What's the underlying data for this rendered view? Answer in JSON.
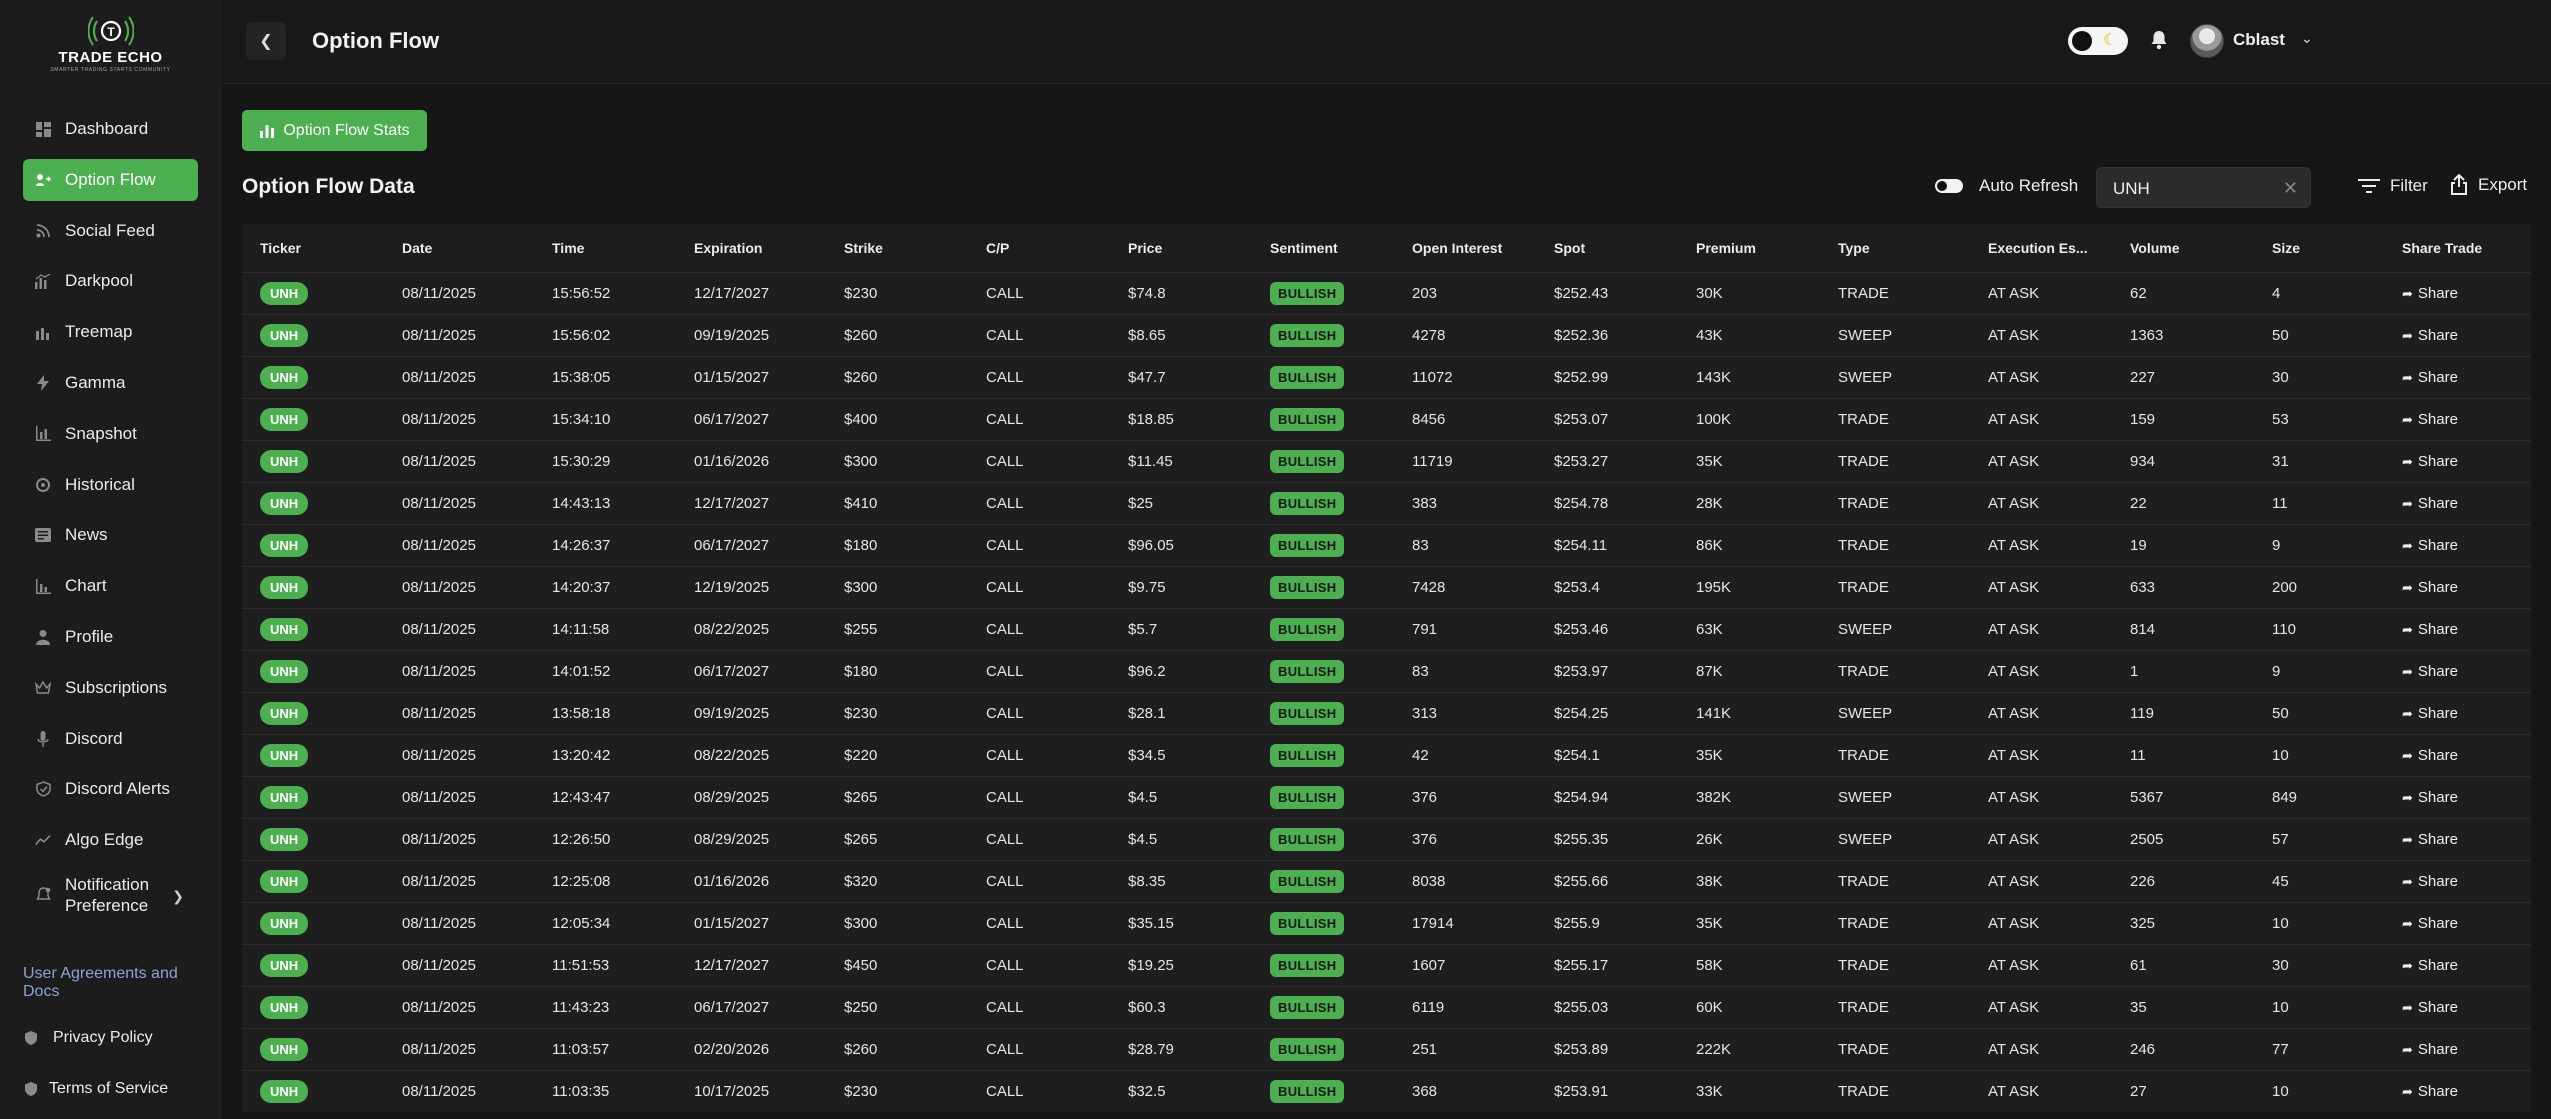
{
  "brand": {
    "name_part1": "TRADE",
    "name_part2": "ECHO",
    "tagline": "SMARTER TRADING STARTS COMMUNITY"
  },
  "sidebar": {
    "items": [
      {
        "label": "Dashboard",
        "icon": "dashboard-icon",
        "active": false
      },
      {
        "label": "Option Flow",
        "icon": "option-flow-icon",
        "active": true
      },
      {
        "label": "Social Feed",
        "icon": "rss-icon",
        "active": false
      },
      {
        "label": "Darkpool",
        "icon": "darkpool-icon",
        "active": false
      },
      {
        "label": "Treemap",
        "icon": "treemap-icon",
        "active": false
      },
      {
        "label": "Gamma",
        "icon": "bolt-icon",
        "active": false
      },
      {
        "label": "Snapshot",
        "icon": "snapshot-icon",
        "active": false
      },
      {
        "label": "Historical",
        "icon": "historical-icon",
        "active": false
      },
      {
        "label": "News",
        "icon": "news-icon",
        "active": false
      },
      {
        "label": "Chart",
        "icon": "chart-icon",
        "active": false
      },
      {
        "label": "Profile",
        "icon": "user-icon",
        "active": false
      },
      {
        "label": "Subscriptions",
        "icon": "crown-icon",
        "active": false
      },
      {
        "label": "Discord",
        "icon": "mic-icon",
        "active": false
      },
      {
        "label": "Discord Alerts",
        "icon": "shield-alert-icon",
        "active": false
      },
      {
        "label": "Algo Edge",
        "icon": "trend-icon",
        "active": false
      }
    ],
    "notification_label_line1": "Notification",
    "notification_label_line2": "Preference",
    "section_title": "User Agreements and Docs",
    "privacy_label": "Privacy Policy",
    "terms_label": "Terms of Service"
  },
  "header": {
    "title": "Option Flow",
    "username": "Cblast"
  },
  "main": {
    "stats_button": "Option Flow Stats",
    "section_title": "Option Flow Data",
    "auto_refresh_label": "Auto Refresh",
    "search_value": "UNH",
    "filter_label": "Filter",
    "export_label": "Export"
  },
  "table": {
    "columns": [
      "Ticker",
      "Date",
      "Time",
      "Expiration",
      "Strike",
      "C/P",
      "Price",
      "Sentiment",
      "Open Interest",
      "Spot",
      "Premium",
      "Type",
      "Execution Es...",
      "Volume",
      "Size",
      "Share Trade"
    ],
    "share_label": "Share",
    "rows": [
      [
        "UNH",
        "08/11/2025",
        "15:56:52",
        "12/17/2027",
        "$230",
        "CALL",
        "$74.8",
        "BULLISH",
        "203",
        "$252.43",
        "30K",
        "TRADE",
        "AT ASK",
        "62",
        "4"
      ],
      [
        "UNH",
        "08/11/2025",
        "15:56:02",
        "09/19/2025",
        "$260",
        "CALL",
        "$8.65",
        "BULLISH",
        "4278",
        "$252.36",
        "43K",
        "SWEEP",
        "AT ASK",
        "1363",
        "50"
      ],
      [
        "UNH",
        "08/11/2025",
        "15:38:05",
        "01/15/2027",
        "$260",
        "CALL",
        "$47.7",
        "BULLISH",
        "11072",
        "$252.99",
        "143K",
        "SWEEP",
        "AT ASK",
        "227",
        "30"
      ],
      [
        "UNH",
        "08/11/2025",
        "15:34:10",
        "06/17/2027",
        "$400",
        "CALL",
        "$18.85",
        "BULLISH",
        "8456",
        "$253.07",
        "100K",
        "TRADE",
        "AT ASK",
        "159",
        "53"
      ],
      [
        "UNH",
        "08/11/2025",
        "15:30:29",
        "01/16/2026",
        "$300",
        "CALL",
        "$11.45",
        "BULLISH",
        "11719",
        "$253.27",
        "35K",
        "TRADE",
        "AT ASK",
        "934",
        "31"
      ],
      [
        "UNH",
        "08/11/2025",
        "14:43:13",
        "12/17/2027",
        "$410",
        "CALL",
        "$25",
        "BULLISH",
        "383",
        "$254.78",
        "28K",
        "TRADE",
        "AT ASK",
        "22",
        "11"
      ],
      [
        "UNH",
        "08/11/2025",
        "14:26:37",
        "06/17/2027",
        "$180",
        "CALL",
        "$96.05",
        "BULLISH",
        "83",
        "$254.11",
        "86K",
        "TRADE",
        "AT ASK",
        "19",
        "9"
      ],
      [
        "UNH",
        "08/11/2025",
        "14:20:37",
        "12/19/2025",
        "$300",
        "CALL",
        "$9.75",
        "BULLISH",
        "7428",
        "$253.4",
        "195K",
        "TRADE",
        "AT ASK",
        "633",
        "200"
      ],
      [
        "UNH",
        "08/11/2025",
        "14:11:58",
        "08/22/2025",
        "$255",
        "CALL",
        "$5.7",
        "BULLISH",
        "791",
        "$253.46",
        "63K",
        "SWEEP",
        "AT ASK",
        "814",
        "110"
      ],
      [
        "UNH",
        "08/11/2025",
        "14:01:52",
        "06/17/2027",
        "$180",
        "CALL",
        "$96.2",
        "BULLISH",
        "83",
        "$253.97",
        "87K",
        "TRADE",
        "AT ASK",
        "1",
        "9"
      ],
      [
        "UNH",
        "08/11/2025",
        "13:58:18",
        "09/19/2025",
        "$230",
        "CALL",
        "$28.1",
        "BULLISH",
        "313",
        "$254.25",
        "141K",
        "SWEEP",
        "AT ASK",
        "119",
        "50"
      ],
      [
        "UNH",
        "08/11/2025",
        "13:20:42",
        "08/22/2025",
        "$220",
        "CALL",
        "$34.5",
        "BULLISH",
        "42",
        "$254.1",
        "35K",
        "TRADE",
        "AT ASK",
        "11",
        "10"
      ],
      [
        "UNH",
        "08/11/2025",
        "12:43:47",
        "08/29/2025",
        "$265",
        "CALL",
        "$4.5",
        "BULLISH",
        "376",
        "$254.94",
        "382K",
        "SWEEP",
        "AT ASK",
        "5367",
        "849"
      ],
      [
        "UNH",
        "08/11/2025",
        "12:26:50",
        "08/29/2025",
        "$265",
        "CALL",
        "$4.5",
        "BULLISH",
        "376",
        "$255.35",
        "26K",
        "SWEEP",
        "AT ASK",
        "2505",
        "57"
      ],
      [
        "UNH",
        "08/11/2025",
        "12:25:08",
        "01/16/2026",
        "$320",
        "CALL",
        "$8.35",
        "BULLISH",
        "8038",
        "$255.66",
        "38K",
        "TRADE",
        "AT ASK",
        "226",
        "45"
      ],
      [
        "UNH",
        "08/11/2025",
        "12:05:34",
        "01/15/2027",
        "$300",
        "CALL",
        "$35.15",
        "BULLISH",
        "17914",
        "$255.9",
        "35K",
        "TRADE",
        "AT ASK",
        "325",
        "10"
      ],
      [
        "UNH",
        "08/11/2025",
        "11:51:53",
        "12/17/2027",
        "$450",
        "CALL",
        "$19.25",
        "BULLISH",
        "1607",
        "$255.17",
        "58K",
        "TRADE",
        "AT ASK",
        "61",
        "30"
      ],
      [
        "UNH",
        "08/11/2025",
        "11:43:23",
        "06/17/2027",
        "$250",
        "CALL",
        "$60.3",
        "BULLISH",
        "6119",
        "$255.03",
        "60K",
        "TRADE",
        "AT ASK",
        "35",
        "10"
      ],
      [
        "UNH",
        "08/11/2025",
        "11:03:57",
        "02/20/2026",
        "$260",
        "CALL",
        "$28.79",
        "BULLISH",
        "251",
        "$253.89",
        "222K",
        "TRADE",
        "AT ASK",
        "246",
        "77"
      ],
      [
        "UNH",
        "08/11/2025",
        "11:03:35",
        "10/17/2025",
        "$230",
        "CALL",
        "$32.5",
        "BULLISH",
        "368",
        "$253.91",
        "33K",
        "TRADE",
        "AT ASK",
        "27",
        "10"
      ]
    ]
  },
  "colors": {
    "accent": "#4caf50",
    "background": "#161616",
    "sidebar": "#1c1c1c",
    "link": "#8da3d6"
  }
}
